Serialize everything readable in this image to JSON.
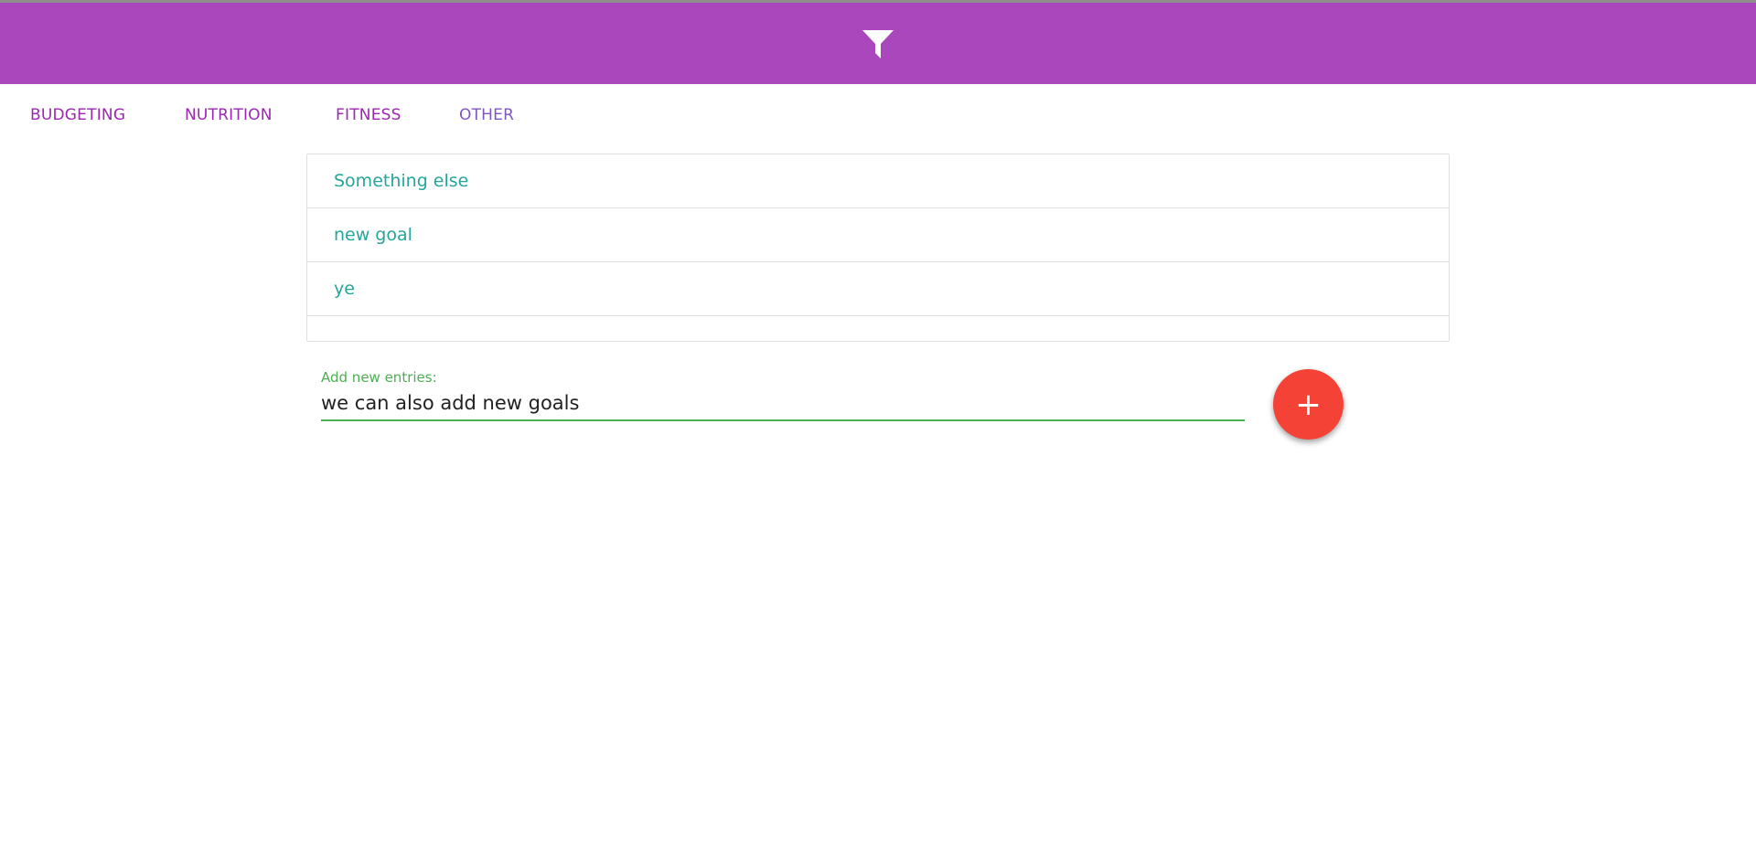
{
  "header": {
    "icon": "filter-icon",
    "background_color": "#ab47bc"
  },
  "tabs": [
    {
      "label": "BUDGETING"
    },
    {
      "label": "NUTRITION"
    },
    {
      "label": "FITNESS"
    },
    {
      "label": "OTHER"
    }
  ],
  "goals": [
    {
      "label": "Something else"
    },
    {
      "label": "new goal"
    },
    {
      "label": "ye"
    }
  ],
  "entry": {
    "label": "Add new entries:",
    "value": "we can also add new goals"
  },
  "add_button": {
    "glyph": "+",
    "icon": "plus-icon",
    "color": "#f44336"
  },
  "colors": {
    "tab_text": "#9c27b0",
    "goal_text": "#26a69a",
    "entry_accent": "#4caf50"
  }
}
